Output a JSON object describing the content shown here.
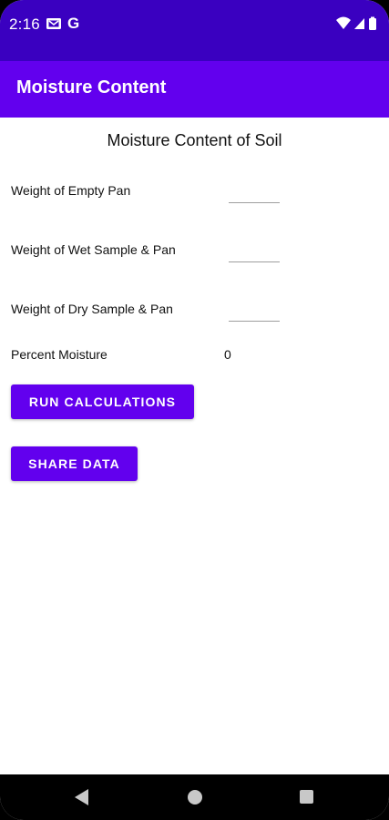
{
  "status_bar": {
    "time": "2:16",
    "icons": [
      "mail-icon",
      "google-g-icon",
      "wifi-icon",
      "cell-signal-icon",
      "battery-icon"
    ],
    "google_letter": "G"
  },
  "app_bar": {
    "title": "Moisture Content"
  },
  "main": {
    "title": "Moisture Content of Soil",
    "fields": [
      {
        "label": "Weight of Empty Pan",
        "value": "",
        "placeholder": ""
      },
      {
        "label": "Weight of Wet Sample & Pan",
        "value": "",
        "placeholder": ""
      },
      {
        "label": "Weight of Dry Sample & Pan",
        "value": "",
        "placeholder": ""
      }
    ],
    "result": {
      "label": "Percent Moisture",
      "value": "0"
    },
    "buttons": {
      "run": "RUN CALCULATIONS",
      "share": "SHARE DATA"
    }
  },
  "nav_bar": {
    "icons": [
      "back-icon",
      "home-icon",
      "recents-icon"
    ]
  },
  "colors": {
    "status_bar": "#3a00c0",
    "primary": "#6200ee",
    "background": "#ffffff",
    "text": "#111111"
  }
}
